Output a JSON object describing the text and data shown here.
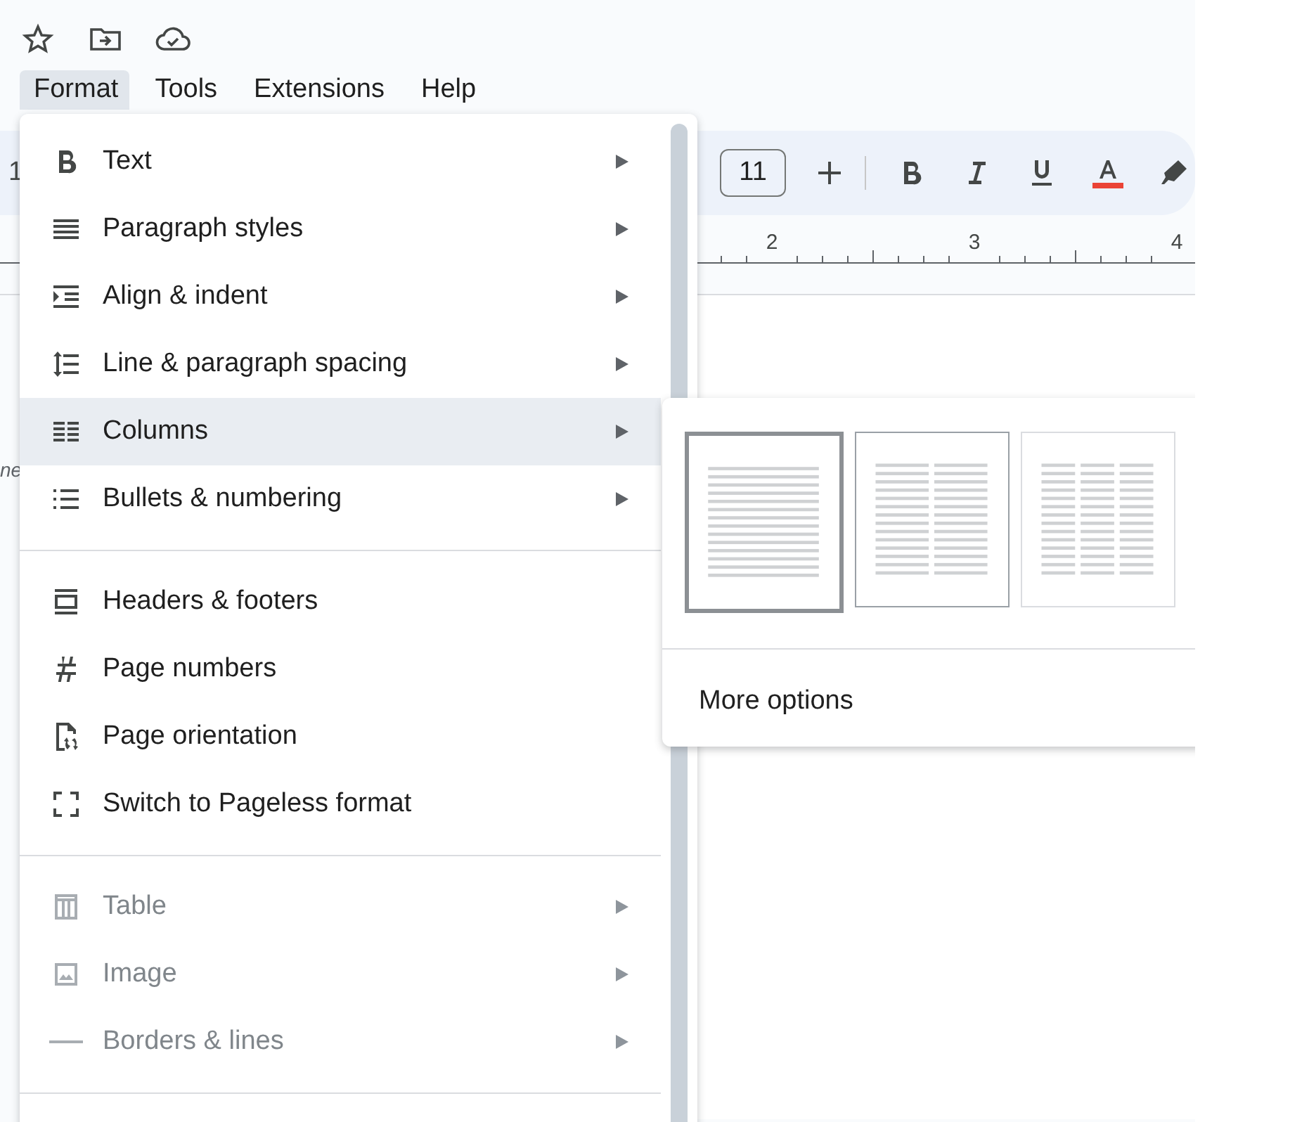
{
  "menu_bar": [
    {
      "label": "Format",
      "selected": true
    },
    {
      "label": "Tools",
      "selected": false
    },
    {
      "label": "Extensions",
      "selected": false
    },
    {
      "label": "Help",
      "selected": false
    }
  ],
  "left_edge": {
    "toolbar_text": "1",
    "document_text": "ne"
  },
  "toolbar": {
    "font_size": "11"
  },
  "ruler": {
    "labels": [
      "2",
      "3",
      "4"
    ]
  },
  "format_menu": {
    "sections": [
      {
        "items": [
          {
            "kind": "bold",
            "label": "Text",
            "submenu": true,
            "disabled": false,
            "selected": false
          },
          {
            "kind": "paragraph",
            "label": "Paragraph styles",
            "submenu": true,
            "disabled": false,
            "selected": false
          },
          {
            "kind": "indent",
            "label": "Align & indent",
            "submenu": true,
            "disabled": false,
            "selected": false
          },
          {
            "kind": "spacing",
            "label": "Line & paragraph spacing",
            "submenu": true,
            "disabled": false,
            "selected": false
          },
          {
            "kind": "columns",
            "label": "Columns",
            "submenu": true,
            "disabled": false,
            "selected": true
          },
          {
            "kind": "bullets",
            "label": "Bullets & numbering",
            "submenu": true,
            "disabled": false,
            "selected": false
          }
        ]
      },
      {
        "items": [
          {
            "kind": "header",
            "label": "Headers & footers",
            "submenu": false,
            "disabled": false,
            "selected": false
          },
          {
            "kind": "hash",
            "label": "Page numbers",
            "submenu": false,
            "disabled": false,
            "selected": false
          },
          {
            "kind": "orientation",
            "label": "Page orientation",
            "submenu": false,
            "disabled": false,
            "selected": false
          },
          {
            "kind": "pageless",
            "label": "Switch to Pageless format",
            "submenu": false,
            "disabled": false,
            "selected": false
          }
        ]
      },
      {
        "items": [
          {
            "kind": "table",
            "label": "Table",
            "submenu": true,
            "disabled": true,
            "selected": false
          },
          {
            "kind": "image",
            "label": "Image",
            "submenu": true,
            "disabled": true,
            "selected": false
          },
          {
            "kind": "line",
            "label": "Borders & lines",
            "submenu": true,
            "disabled": true,
            "selected": false
          }
        ]
      }
    ]
  },
  "columns_submenu": {
    "options": [
      {
        "kind": "one",
        "selected": true,
        "hovered": false
      },
      {
        "kind": "two",
        "selected": false,
        "hovered": true
      },
      {
        "kind": "three",
        "selected": false,
        "hovered": false
      }
    ],
    "more_options": "More options"
  }
}
